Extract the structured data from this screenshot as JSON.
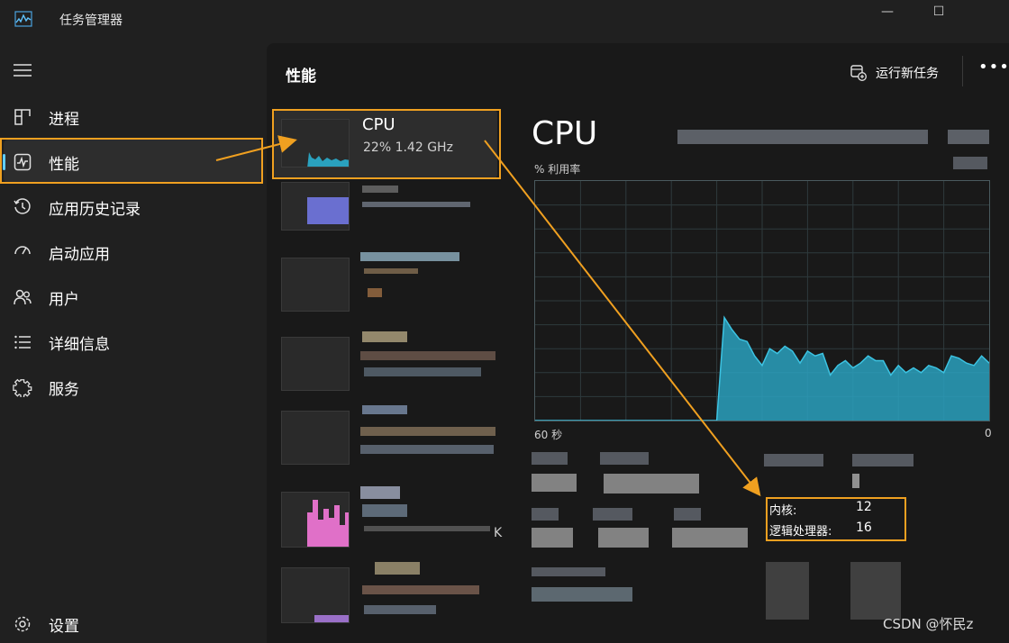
{
  "window": {
    "title": "任务管理器",
    "controls": {
      "minimize": "—",
      "maximize": "☐"
    }
  },
  "sidebar": {
    "items": [
      {
        "label": "进程",
        "icon": "processes-icon"
      },
      {
        "label": "性能",
        "icon": "performance-icon",
        "active": true
      },
      {
        "label": "应用历史记录",
        "icon": "history-icon"
      },
      {
        "label": "启动应用",
        "icon": "startup-icon"
      },
      {
        "label": "用户",
        "icon": "users-icon"
      },
      {
        "label": "详细信息",
        "icon": "details-icon"
      },
      {
        "label": "服务",
        "icon": "services-icon"
      }
    ],
    "settings_label": "设置"
  },
  "header": {
    "title": "性能",
    "run_task_label": "运行新任务",
    "more_label": "•••"
  },
  "devices": {
    "cpu": {
      "name": "CPU",
      "summary": "22%  1.42 GHz"
    },
    "stray_letter": "K"
  },
  "detail": {
    "title": "CPU",
    "utilization_label": "% 利用率",
    "axis_left": "60 秒",
    "axis_right": "0",
    "cores_label": "内核:",
    "cores_value": "12",
    "logical_label": "逻辑处理器:",
    "logical_value": "16"
  },
  "chart_data": {
    "type": "area",
    "ylim": [
      0,
      100
    ],
    "x": [
      60,
      59,
      58,
      57,
      56,
      55,
      54,
      53,
      52,
      51,
      50,
      49,
      48,
      47,
      46,
      45,
      44,
      43,
      42,
      41,
      40,
      39,
      38,
      37,
      36,
      35,
      34,
      33,
      32,
      31,
      30,
      29,
      28,
      27,
      26,
      25,
      24,
      23,
      22,
      21,
      20,
      19,
      18,
      17,
      16,
      15,
      14,
      13,
      12,
      11,
      10,
      9,
      8,
      7,
      6,
      5,
      4,
      3,
      2,
      1,
      0
    ],
    "values": [
      0,
      0,
      0,
      0,
      0,
      0,
      0,
      0,
      0,
      0,
      0,
      0,
      0,
      0,
      0,
      0,
      0,
      0,
      0,
      0,
      0,
      0,
      0,
      0,
      0,
      43,
      38,
      34,
      33,
      27,
      23,
      30,
      28,
      31,
      29,
      24,
      29,
      27,
      28,
      19,
      23,
      25,
      22,
      24,
      27,
      25,
      25,
      19,
      23,
      20,
      22,
      20,
      23,
      22,
      20,
      27,
      26,
      24,
      23,
      27,
      24
    ],
    "color": "#2aa1be",
    "grid": true
  },
  "colors": {
    "accent": "#60cdff",
    "annotation": "#f0a020",
    "cpu_fill": "#2aa1be",
    "gpu_thumb": "#6a6fd0",
    "pink_thumb": "#e070c8"
  },
  "watermark": "CSDN @怀民z"
}
